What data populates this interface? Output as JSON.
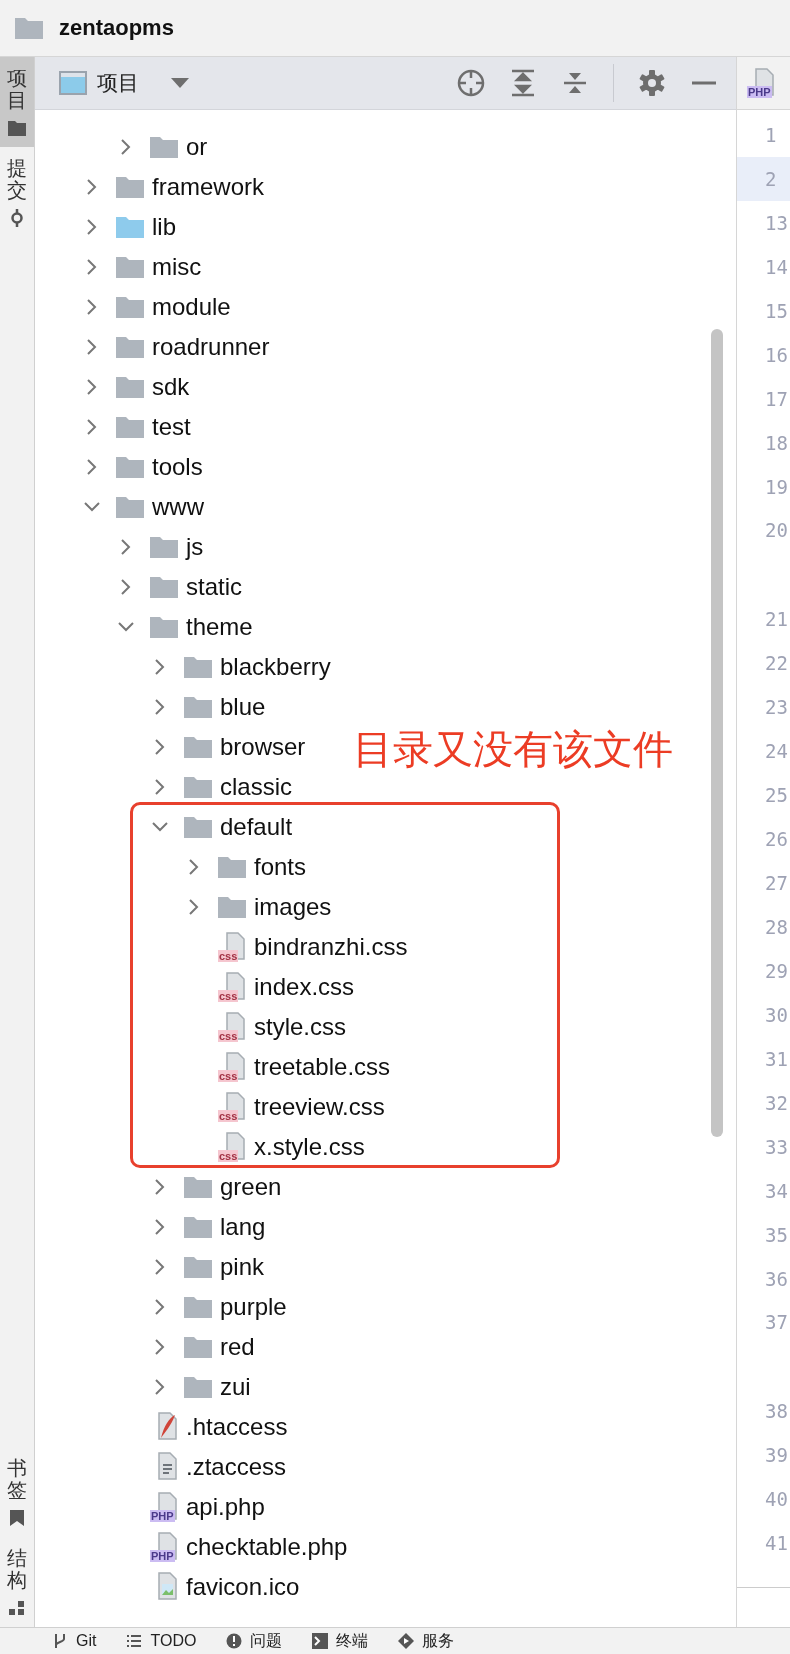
{
  "project": {
    "name": "zentaopms"
  },
  "side_tabs": {
    "top": [
      {
        "label": "项目",
        "kind": "folder",
        "selected": true
      },
      {
        "label": "提交",
        "kind": "commit",
        "selected": false
      }
    ],
    "bottom": [
      {
        "label": "书签",
        "kind": "bookmark",
        "selected": false
      },
      {
        "label": "结构",
        "kind": "structure",
        "selected": false
      }
    ]
  },
  "panel": {
    "title": "项目"
  },
  "tree": [
    {
      "children": [
        {
          "name": "or",
          "kind": "folder",
          "expanded": false
        }
      ]
    },
    {
      "name": "framework",
      "kind": "folder",
      "expanded": false
    },
    {
      "name": "lib",
      "kind": "library",
      "expanded": false
    },
    {
      "name": "misc",
      "kind": "folder",
      "expanded": false
    },
    {
      "name": "module",
      "kind": "folder",
      "expanded": false
    },
    {
      "name": "roadrunner",
      "kind": "folder",
      "expanded": false
    },
    {
      "name": "sdk",
      "kind": "folder",
      "expanded": false
    },
    {
      "name": "test",
      "kind": "folder",
      "expanded": false
    },
    {
      "name": "tools",
      "kind": "folder",
      "expanded": false
    },
    {
      "name": "www",
      "kind": "folder",
      "expanded": true,
      "children": [
        {
          "name": "js",
          "kind": "folder",
          "expanded": false
        },
        {
          "name": "static",
          "kind": "folder",
          "expanded": false
        },
        {
          "name": "theme",
          "kind": "folder",
          "expanded": true,
          "children": [
            {
              "name": "blackberry",
              "kind": "folder",
              "expanded": false
            },
            {
              "name": "blue",
              "kind": "folder",
              "expanded": false
            },
            {
              "name": "browser",
              "kind": "folder",
              "expanded": false
            },
            {
              "name": "classic",
              "kind": "folder",
              "expanded": false
            },
            {
              "name": "default",
              "kind": "folder",
              "expanded": true,
              "children": [
                {
                  "name": "fonts",
                  "kind": "folder",
                  "expanded": false
                },
                {
                  "name": "images",
                  "kind": "folder",
                  "expanded": false
                },
                {
                  "name": "bindranzhi.css",
                  "kind": "css",
                  "badge": "css"
                },
                {
                  "name": "index.css",
                  "kind": "css",
                  "badge": "css"
                },
                {
                  "name": "style.css",
                  "kind": "css",
                  "badge": "css"
                },
                {
                  "name": "treetable.css",
                  "kind": "css",
                  "badge": "css"
                },
                {
                  "name": "treeview.css",
                  "kind": "css",
                  "badge": "css"
                },
                {
                  "name": "x.style.css",
                  "kind": "css",
                  "badge": "css"
                }
              ]
            },
            {
              "name": "green",
              "kind": "folder",
              "expanded": false
            },
            {
              "name": "lang",
              "kind": "folder",
              "expanded": false
            },
            {
              "name": "pink",
              "kind": "folder",
              "expanded": false
            },
            {
              "name": "purple",
              "kind": "folder",
              "expanded": false
            },
            {
              "name": "red",
              "kind": "folder",
              "expanded": false
            },
            {
              "name": "zui",
              "kind": "folder",
              "expanded": false
            }
          ]
        },
        {
          "name": ".htaccess",
          "kind": "apache"
        },
        {
          "name": ".ztaccess",
          "kind": "text"
        },
        {
          "name": "api.php",
          "kind": "php",
          "badge": "PHP"
        },
        {
          "name": "checktable.php",
          "kind": "php",
          "badge": "PHP"
        },
        {
          "name": "favicon.ico",
          "kind": "image"
        }
      ]
    }
  ],
  "annotation": {
    "text": "目录又没有该文件"
  },
  "editor": {
    "tab_badge": "PHP",
    "lines": [
      {
        "number": "1",
        "current": false,
        "wrapped": false
      },
      {
        "number": "2",
        "current": true,
        "wrapped": false
      },
      {
        "number": "13",
        "current": false,
        "wrapped": false
      },
      {
        "number": "14",
        "current": false,
        "wrapped": false
      },
      {
        "number": "15",
        "current": false,
        "wrapped": false
      },
      {
        "number": "16",
        "current": false,
        "wrapped": false
      },
      {
        "number": "17",
        "current": false,
        "wrapped": false
      },
      {
        "number": "18",
        "current": false,
        "wrapped": false
      },
      {
        "number": "19",
        "current": false,
        "wrapped": false
      },
      {
        "number": "20",
        "current": false,
        "wrapped": true
      },
      {
        "number": "21",
        "current": false,
        "wrapped": false
      },
      {
        "number": "22",
        "current": false,
        "wrapped": false
      },
      {
        "number": "23",
        "current": false,
        "wrapped": false
      },
      {
        "number": "24",
        "current": false,
        "wrapped": false
      },
      {
        "number": "25",
        "current": false,
        "wrapped": false
      },
      {
        "number": "26",
        "current": false,
        "wrapped": false
      },
      {
        "number": "27",
        "current": false,
        "wrapped": false
      },
      {
        "number": "28",
        "current": false,
        "wrapped": false
      },
      {
        "number": "29",
        "current": false,
        "wrapped": false
      },
      {
        "number": "30",
        "current": false,
        "wrapped": false
      },
      {
        "number": "31",
        "current": false,
        "wrapped": false
      },
      {
        "number": "32",
        "current": false,
        "wrapped": false
      },
      {
        "number": "33",
        "current": false,
        "wrapped": false
      },
      {
        "number": "34",
        "current": false,
        "wrapped": false
      },
      {
        "number": "35",
        "current": false,
        "wrapped": false
      },
      {
        "number": "36",
        "current": false,
        "wrapped": false
      },
      {
        "number": "37",
        "current": false,
        "wrapped": true
      },
      {
        "number": "38",
        "current": false,
        "wrapped": false
      },
      {
        "number": "39",
        "current": false,
        "wrapped": false
      },
      {
        "number": "40",
        "current": false,
        "wrapped": false
      },
      {
        "number": "41",
        "current": false,
        "wrapped": false
      }
    ]
  },
  "bottom_bar": [
    {
      "label": "Git",
      "kind": "git"
    },
    {
      "label": "TODO",
      "kind": "list"
    },
    {
      "label": "问题",
      "kind": "problem"
    },
    {
      "label": "终端",
      "kind": "terminal"
    },
    {
      "label": "服务",
      "kind": "service"
    }
  ]
}
